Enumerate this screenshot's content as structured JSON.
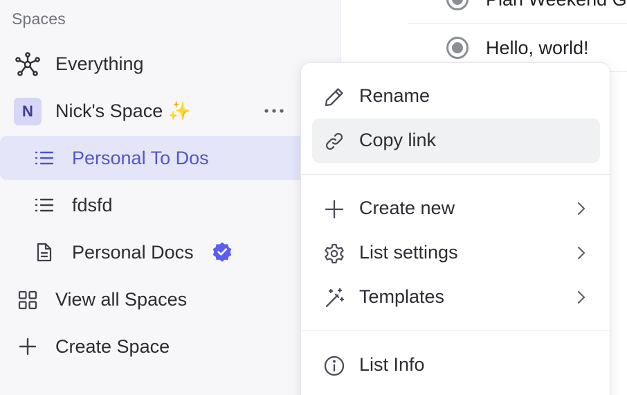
{
  "sidebar": {
    "heading": "Spaces",
    "everything_label": "Everything",
    "space": {
      "avatar_letter": "N",
      "name": "Nick's Space ✨"
    },
    "lists": [
      {
        "label": "Personal To Dos",
        "icon": "list-icon",
        "active": true
      },
      {
        "label": "fdsfd",
        "icon": "list-icon",
        "active": false
      },
      {
        "label": "Personal Docs",
        "icon": "document-icon",
        "active": false,
        "badge": "verified-badge-icon"
      }
    ],
    "view_all_label": "View all Spaces",
    "create_label": "Create Space"
  },
  "tasks": [
    {
      "label": "Plan Weekend G"
    },
    {
      "label": "Hello, world!"
    }
  ],
  "context_menu": {
    "items": [
      {
        "label": "Rename",
        "icon": "pencil-icon"
      },
      {
        "label": "Copy link",
        "icon": "link-icon"
      },
      {
        "label": "Create new",
        "icon": "plus-icon"
      },
      {
        "label": "List settings",
        "icon": "gear-icon"
      },
      {
        "label": "Templates",
        "icon": "magic-wand-icon"
      },
      {
        "label": "List Info",
        "icon": "info-icon"
      }
    ]
  },
  "colors": {
    "accent": "#5156c9",
    "active_bg": "#e5e5fa",
    "verified": "#5b5ef0",
    "sidebar_bg": "#f7f7f9"
  }
}
